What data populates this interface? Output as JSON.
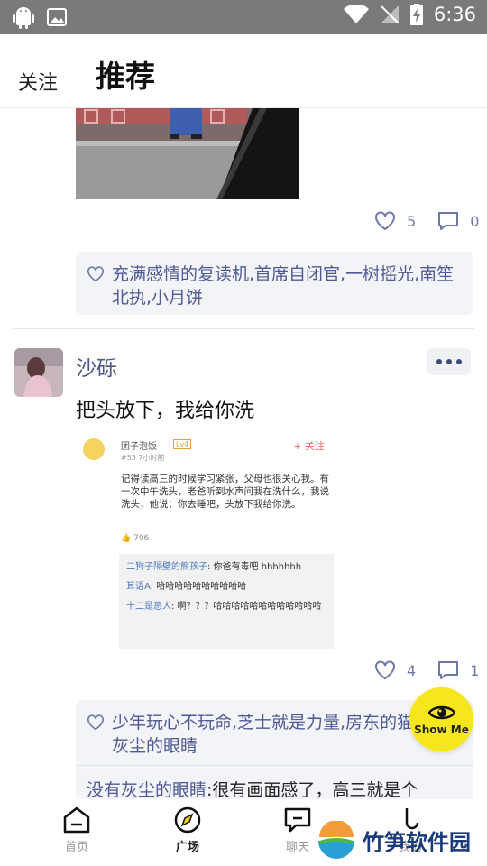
{
  "status_bar": {
    "time": "6:36"
  },
  "header": {
    "tab_follow": "关注",
    "tab_recommend": "推荐"
  },
  "post1": {
    "likes": "5",
    "comments": "0",
    "liked_by": "充满感情的复读机,首席自闭官,一树摇光,南笙北执,小月饼"
  },
  "post2": {
    "username": "沙砾",
    "text": "把头放下，我给你洗",
    "image": {
      "author": "团子泡饭",
      "badge": "Lv4",
      "follow": "+ 关注",
      "meta": "#53  7小时前",
      "body": "记得读高三的时候学习紧张，父母也很关心我。有一次中午洗头，老爸听到水声问我在洗什么，我说洗头，他说：你去睡吧，头放下我给你洗。",
      "like_count": "706",
      "comments": [
        {
          "name": "二狗子隔壁的熊孩子",
          "text": ": 你爸有毒吧 hhhhhhh"
        },
        {
          "name": "耳语A",
          "text": ": 哈哈哈哈哈哈哈哈哈哈"
        },
        {
          "name": "十二是恶人",
          "text": ": 啊？？？哈哈哈哈哈哈哈哈哈哈哈哈"
        }
      ]
    },
    "likes": "4",
    "comments": "1",
    "liked_by": "少年玩心不玩命,芝士就是力量,房东的猫,没有灰尘的眼睛",
    "top_comment_name": "没有灰尘的眼睛",
    "top_comment_text": ":很有画面感了，高三就是个"
  },
  "show_me": {
    "label": "Show Me"
  },
  "bottom_nav": {
    "items": [
      {
        "label": "首页",
        "icon": "home-icon"
      },
      {
        "label": "广场",
        "icon": "compass-icon"
      },
      {
        "label": "聊天",
        "icon": "chat-icon"
      },
      {
        "label": "我的",
        "icon": "profile-icon"
      }
    ]
  },
  "watermark": {
    "text": "竹笋软件园"
  }
}
